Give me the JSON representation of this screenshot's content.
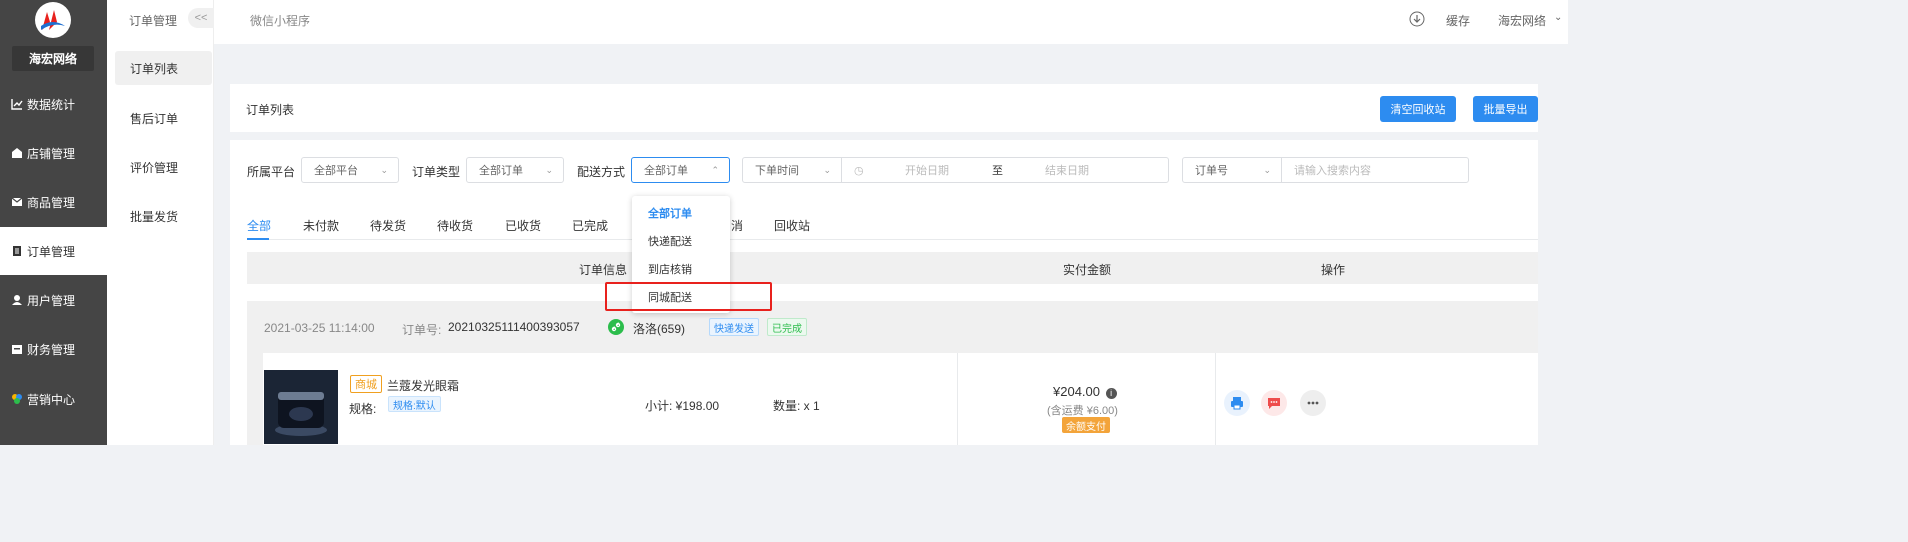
{
  "brand": {
    "name": "海宏网络"
  },
  "sidebar": {
    "items": [
      {
        "label": "数据统计",
        "icon": "chart-line-icon"
      },
      {
        "label": "店铺管理",
        "icon": "store-icon"
      },
      {
        "label": "商品管理",
        "icon": "mail-icon"
      },
      {
        "label": "订单管理",
        "icon": "clipboard-icon",
        "active": true
      },
      {
        "label": "用户管理",
        "icon": "user-icon"
      },
      {
        "label": "财务管理",
        "icon": "finance-icon"
      },
      {
        "label": "营销中心",
        "icon": "marketing-icon"
      }
    ]
  },
  "submenu": {
    "heading": "订单管理",
    "collapse": "<<",
    "items": [
      "订单列表",
      "售后订单",
      "评价管理",
      "批量发货"
    ]
  },
  "topbar": {
    "crumb": "微信小程序",
    "cache": "缓存",
    "user": "海宏网络"
  },
  "page": {
    "title": "订单列表",
    "clear_recycle": "清空回收站",
    "batch_export": "批量导出"
  },
  "filters": {
    "platform_label": "所属平台",
    "platform_value": "全部平台",
    "type_label": "订单类型",
    "type_value": "全部订单",
    "delivery_label": "配送方式",
    "delivery_value": "全部订单",
    "time_value": "下单时间",
    "start_placeholder": "开始日期",
    "to": "至",
    "end_placeholder": "结束日期",
    "order_field": "订单号",
    "search_placeholder": "请输入搜索内容"
  },
  "delivery_options": [
    "全部订单",
    "快递配送",
    "到店核销",
    "同城配送"
  ],
  "tabs": [
    "全部",
    "未付款",
    "待发货",
    "待收货",
    "已收货",
    "已完成",
    "消",
    "回收站"
  ],
  "table": {
    "headers": [
      "订单信息",
      "实付金额",
      "操作"
    ]
  },
  "order": {
    "time": "2021-03-25 11:14:00",
    "no_label": "订单号:",
    "no": "20210325111400393057",
    "buyer": "洛洛(659)",
    "delivery_tag": "快递发送",
    "status_tag": "已完成",
    "product_tag": "商城",
    "product_name": "兰蔻发光眼霜",
    "spec_label": "规格:",
    "spec_value": "规格:默认",
    "subtotal": "小计: ¥198.00",
    "quantity": "数量: x 1",
    "price": "¥204.00",
    "freight": "(含运费 ¥6.00)",
    "pay_tag": "余额支付"
  },
  "colors": {
    "primary": "#2d8cf0",
    "sidebar": "#454545",
    "highlight": "#e8211d",
    "pay": "#f3a43a",
    "wechat": "#2cbd4c"
  }
}
